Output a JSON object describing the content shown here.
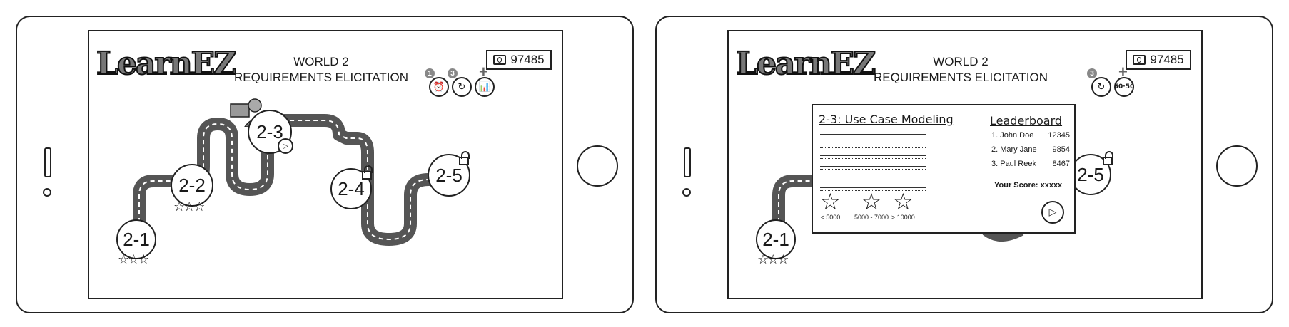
{
  "screen_left": {
    "header": {
      "logo": "LearnEZ",
      "world": "WORLD 2",
      "subtitle": "REQUIREMENTS ELICITATION",
      "coins": "97485"
    },
    "powerups": [
      {
        "name": "timer",
        "count": "1",
        "icon": "alarm-clock-icon"
      },
      {
        "name": "retry",
        "count": "3",
        "icon": "refresh-icon"
      },
      {
        "name": "stats",
        "icon": "chart-icon",
        "symbol": "+"
      }
    ],
    "levels": [
      {
        "label": "2-1",
        "stars": "☆☆☆"
      },
      {
        "label": "2-2",
        "stars": "☆☆☆"
      },
      {
        "label": "2-3"
      },
      {
        "label": "2-4"
      },
      {
        "label": "2-5"
      }
    ]
  },
  "screen_right": {
    "header": {
      "logo": "LearnEZ",
      "world": "WORLD 2",
      "subtitle": "REQUIREMENTS ELICITATION",
      "coins": "97485"
    },
    "powerups": [
      {
        "name": "retry",
        "count": "3",
        "icon": "refresh-icon"
      },
      {
        "name": "fifty-fifty",
        "label": "50·50",
        "symbol": "+"
      }
    ],
    "levels": [
      {
        "label": "2-1",
        "stars": "☆☆☆"
      },
      {
        "label": "2-5"
      }
    ],
    "modal": {
      "title": "2-3: Use Case Modeling",
      "leaderboard_title": "Leaderboard",
      "leaderboard": [
        {
          "name": "1. John Doe",
          "score": "12345"
        },
        {
          "name": "2. Mary Jane",
          "score": "9854"
        },
        {
          "name": "3. Paul Reek",
          "score": "8467"
        }
      ],
      "your_score": "Your Score:  xxxxx",
      "star_thresholds": [
        "< 5000",
        "5000 - 7000",
        "> 10000"
      ]
    }
  },
  "colors": {
    "road": "#555555",
    "ink": "#222222",
    "badge": "#888888"
  }
}
